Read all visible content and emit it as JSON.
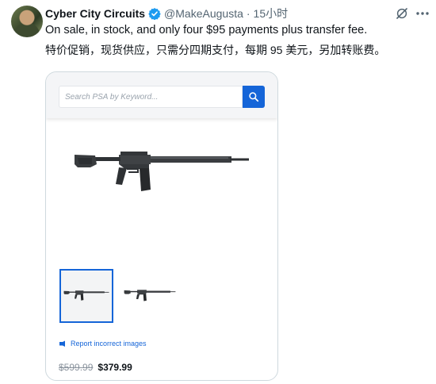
{
  "tweet": {
    "display_name": "Cyber City Circuits",
    "handle": "@MakeAugusta",
    "separator": "·",
    "time": "15小时",
    "text_en": "On sale, in stock, and only four $95 payments plus transfer fee.",
    "text_zh": "特价促销，现货供应，只需分四期支付，每期 95 美元，另加转账费。"
  },
  "icons": {
    "verified": "verified-badge-icon",
    "grok": "grok-icon",
    "more": "more-icon",
    "search": "search-icon",
    "flag": "flag-icon"
  },
  "colors": {
    "verified": "#1d9bf0",
    "accent": "#1565d8",
    "secondary_text": "#536471"
  },
  "media": {
    "search_placeholder": "Search PSA by Keyword...",
    "report_link": "Report incorrect images",
    "old_price": "$599.99",
    "new_price": "$379.99"
  }
}
